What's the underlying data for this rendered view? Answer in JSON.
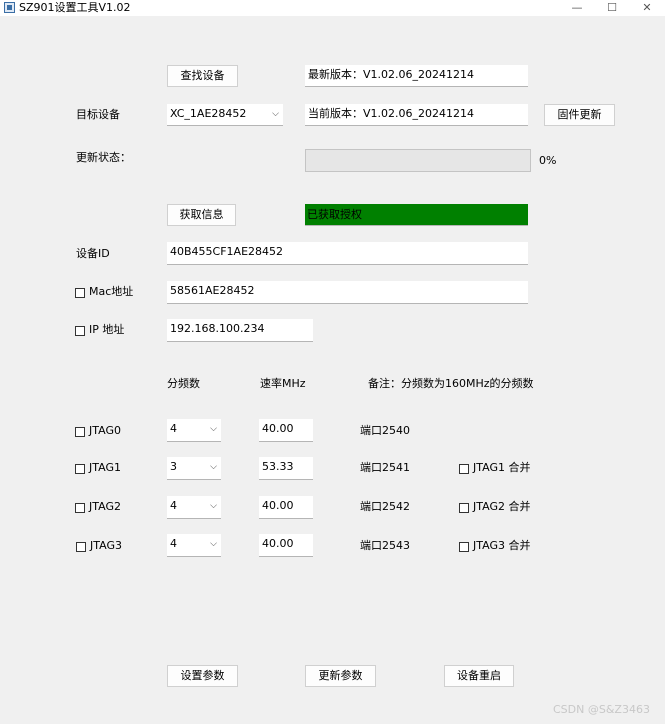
{
  "window": {
    "title": "SZ901设置工具V1.02",
    "minimize": "—",
    "maximize": "☐",
    "close": "✕"
  },
  "top": {
    "find_device": "查找设备",
    "latest_version": "最新版本：V1.02.06_20241214",
    "target_device_label": "目标设备",
    "target_device_value": "XC_1AE28452",
    "current_version": "当前版本：V1.02.06_20241214",
    "firmware_update": "固件更新",
    "update_status_label": "更新状态：",
    "progress_percent": 0,
    "progress_text": "0%"
  },
  "info": {
    "get_info": "获取信息",
    "auth_status": "已获取授权",
    "auth_color": "#008000",
    "device_id_label": "设备ID",
    "device_id_value": "40B455CF1AE28452",
    "mac_label": "Mac地址",
    "mac_value": "58561AE28452",
    "ip_label": "IP 地址",
    "ip_value": "192.168.100.234"
  },
  "jtag": {
    "col_divider": "分频数",
    "col_rate": "速率MHz",
    "note": "备注：分频数为160MHz的分频数",
    "rows": [
      {
        "name": "JTAG0",
        "divider": "4",
        "rate": "40.00",
        "port": "端口2540",
        "merge": ""
      },
      {
        "name": "JTAG1",
        "divider": "3",
        "rate": "53.33",
        "port": "端口2541",
        "merge": "JTAG1 合并"
      },
      {
        "name": "JTAG2",
        "divider": "4",
        "rate": "40.00",
        "port": "端口2542",
        "merge": "JTAG2 合并"
      },
      {
        "name": "JTAG3",
        "divider": "4",
        "rate": "40.00",
        "port": "端口2543",
        "merge": "JTAG3 合并"
      }
    ]
  },
  "bottom": {
    "set_params": "设置参数",
    "update_params": "更新参数",
    "reboot_device": "设备重启"
  },
  "watermark": "CSDN @S&Z3463"
}
